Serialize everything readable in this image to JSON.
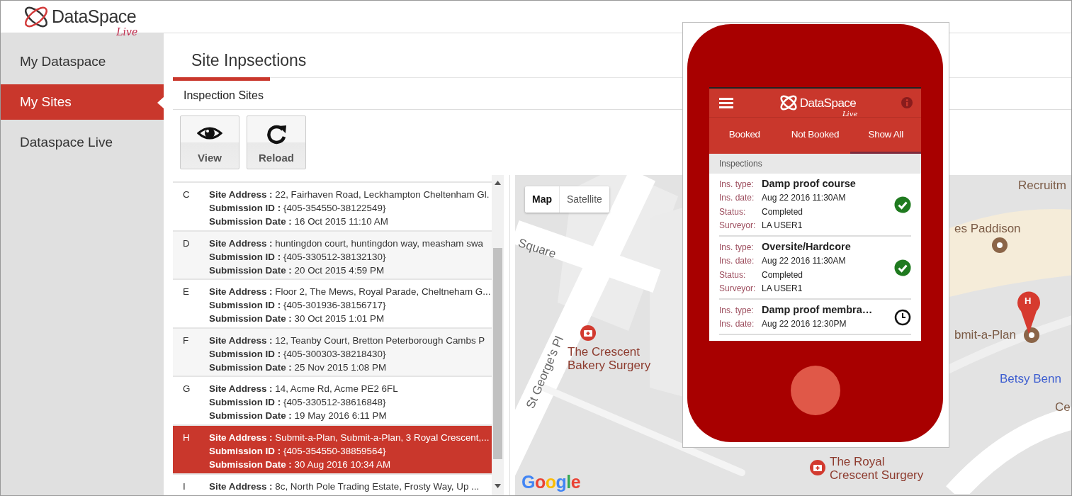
{
  "header": {
    "logo": {
      "main": "DataSpace",
      "script": "Live"
    }
  },
  "sidebar": {
    "items": [
      {
        "label": "My Dataspace",
        "selected": false
      },
      {
        "label": "My Sites",
        "selected": true
      },
      {
        "label": "Dataspace Live",
        "selected": false
      }
    ]
  },
  "page": {
    "title": "Site Inpsections",
    "section": "Inspection Sites"
  },
  "toolbar": {
    "buttons": [
      {
        "label": "View"
      },
      {
        "label": "Reload"
      }
    ]
  },
  "sites": {
    "rows": [
      {
        "letter": "C",
        "selected": false,
        "fields": [
          {
            "label": "Site Address :",
            "value": "22, Fairhaven Road, Leckhampton Cheltenham Gl."
          },
          {
            "label": "Submission ID :",
            "value": "{405-354550-38122549}"
          },
          {
            "label": "Submission Date :",
            "value": "16 Oct 2015 11:10 AM"
          }
        ]
      },
      {
        "letter": "D",
        "selected": false,
        "fields": [
          {
            "label": "Site Address :",
            "value": "huntingdon court, huntingdon way, measham swa"
          },
          {
            "label": "Submission ID :",
            "value": "{405-330512-38132130}"
          },
          {
            "label": "Submission Date :",
            "value": "20 Oct 2015 4:59 PM"
          }
        ]
      },
      {
        "letter": "E",
        "selected": false,
        "fields": [
          {
            "label": "Site Address :",
            "value": "Floor 2, The Mews, Royal Parade, Cheltneham G..."
          },
          {
            "label": "Submission ID :",
            "value": "{405-301936-38156717}"
          },
          {
            "label": "Submission Date :",
            "value": "30 Oct 2015 1:01 PM"
          }
        ]
      },
      {
        "letter": "F",
        "selected": false,
        "fields": [
          {
            "label": "Site Address :",
            "value": "12, Teanby Court, Bretton Peterborough Cambs P"
          },
          {
            "label": "Submission ID :",
            "value": "{405-300303-38218430}"
          },
          {
            "label": "Submission Date :",
            "value": "25 Nov 2015 1:08 PM"
          }
        ]
      },
      {
        "letter": "G",
        "selected": false,
        "fields": [
          {
            "label": "Site Address :",
            "value": "14, Acme Rd, Acme PE2 6FL"
          },
          {
            "label": "Submission ID :",
            "value": "{405-330512-38616848}"
          },
          {
            "label": "Submission Date :",
            "value": "19 May 2016 6:11 PM"
          }
        ]
      },
      {
        "letter": "H",
        "selected": true,
        "fields": [
          {
            "label": "Site Address :",
            "value": "Submit-a-Plan, Submit-a-Plan, 3 Royal Crescent,..."
          },
          {
            "label": "Submission ID :",
            "value": "{405-354550-38859564}"
          },
          {
            "label": "Submission Date :",
            "value": "30 Aug 2016 10:34 AM"
          }
        ]
      },
      {
        "letter": "I",
        "selected": false,
        "fields": [
          {
            "label": "Site Address :",
            "value": "8c, North Pole Trading Estate, Frosty Way, Up ..."
          }
        ]
      }
    ]
  },
  "map": {
    "controls": [
      {
        "label": "Map",
        "selected": true
      },
      {
        "label": "Satellite",
        "selected": false
      }
    ],
    "labels": [
      {
        "text": "Square",
        "kind": "street"
      },
      {
        "text": "St George's Pl",
        "kind": "street"
      },
      {
        "text": "The Crescent\nBakery Surgery",
        "kind": "medical"
      },
      {
        "text": "Recruitm",
        "kind": "place"
      },
      {
        "text": "es Paddison",
        "kind": "place"
      },
      {
        "text": "bmit-a-Plan",
        "kind": "place"
      },
      {
        "text": "Betsy Benn",
        "kind": "shop"
      },
      {
        "text": "Ce",
        "kind": "place"
      },
      {
        "text": "The Royal\nCrescent Surgery",
        "kind": "medical"
      }
    ],
    "marker": {
      "label": "H"
    },
    "brand": "Google"
  },
  "phone": {
    "logo": {
      "main": "DataSpace",
      "script": "Live"
    },
    "tabs": [
      {
        "label": "Booked",
        "selected": false
      },
      {
        "label": "Not Booked",
        "selected": false
      },
      {
        "label": "Show All",
        "selected": true
      }
    ],
    "section": "Inspections",
    "inspections": [
      {
        "kind": "completed",
        "fields": [
          {
            "label": "Ins. type:",
            "value": "Damp proof course"
          },
          {
            "label": "Ins. date:",
            "value": "Aug 22 2016 11:30AM"
          },
          {
            "label": "Status:",
            "value": "Completed"
          },
          {
            "label": "Surveyor:",
            "value": "LA USER1"
          }
        ]
      },
      {
        "kind": "completed",
        "fields": [
          {
            "label": "Ins. type:",
            "value": "Oversite/Hardcore"
          },
          {
            "label": "Ins. date:",
            "value": "Aug 22 2016 11:30AM"
          },
          {
            "label": "Status:",
            "value": "Completed"
          },
          {
            "label": "Surveyor:",
            "value": "LA USER1"
          }
        ]
      },
      {
        "kind": "pending",
        "fields": [
          {
            "label": "Ins. type:",
            "value": "Damp proof membra…"
          },
          {
            "label": "Ins. date:",
            "value": "Aug 22 2016 12:30PM"
          }
        ]
      }
    ]
  }
}
